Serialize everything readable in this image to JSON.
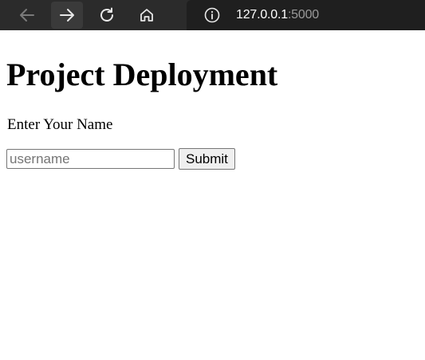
{
  "browser": {
    "address_host": "127.0.0.1",
    "address_port": ":5000",
    "icons": [
      "back-arrow-icon",
      "forward-arrow-icon",
      "reload-icon",
      "home-icon",
      "site-info-icon"
    ]
  },
  "page": {
    "title": "Project Deployment",
    "prompt": "Enter Your Name",
    "input_placeholder": "username",
    "input_value": "",
    "submit_label": "Submit"
  }
}
